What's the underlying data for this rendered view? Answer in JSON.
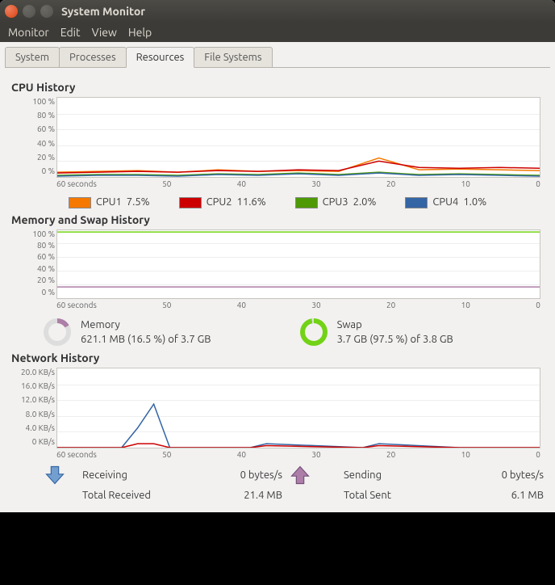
{
  "window": {
    "title": "System Monitor"
  },
  "menu": {
    "items": [
      "Monitor",
      "Edit",
      "View",
      "Help"
    ]
  },
  "tabs": {
    "items": [
      "System",
      "Processes",
      "Resources",
      "File Systems"
    ],
    "active": 2
  },
  "cpu": {
    "title": "CPU History",
    "y_ticks": [
      "100 %",
      "80 %",
      "60 %",
      "40 %",
      "20 %",
      "0 %"
    ],
    "x_ticks": [
      "60",
      "50",
      "40",
      "30",
      "20",
      "10",
      "0"
    ],
    "legend": [
      {
        "label": "CPU1",
        "value": "7.5%",
        "color": "#f57900"
      },
      {
        "label": "CPU2",
        "value": "11.6%",
        "color": "#cc0000"
      },
      {
        "label": "CPU3",
        "value": "2.0%",
        "color": "#4e9a06"
      },
      {
        "label": "CPU4",
        "value": "1.0%",
        "color": "#3465a4"
      }
    ]
  },
  "mem": {
    "title": "Memory and Swap History",
    "y_ticks": [
      "100 %",
      "80 %",
      "60 %",
      "40 %",
      "20 %",
      "0 %"
    ],
    "x_ticks": [
      "60",
      "50",
      "40",
      "30",
      "20",
      "10",
      "0"
    ],
    "memory": {
      "label": "Memory",
      "text": "621.1 MB (16.5 %) of 3.7 GB",
      "pct": 16.5,
      "color": "#ad7fa8"
    },
    "swap": {
      "label": "Swap",
      "text": "3.7 GB (97.5 %) of 3.8 GB",
      "pct": 97.5,
      "color": "#73d216"
    }
  },
  "net": {
    "title": "Network History",
    "y_ticks": [
      "20.0 KB/s",
      "16.0 KB/s",
      "12.0 KB/s",
      "8.0 KB/s",
      "4.0 KB/s",
      "0 KB/s"
    ],
    "x_ticks": [
      "60",
      "50",
      "40",
      "30",
      "20",
      "10",
      "0"
    ],
    "recv": {
      "label": "Receiving",
      "rate": "0 bytes/s",
      "total_label": "Total Received",
      "total": "21.4 MB",
      "color": "#3465a4"
    },
    "send": {
      "label": "Sending",
      "rate": "0 bytes/s",
      "total_label": "Total Sent",
      "total": "6.1 MB",
      "color": "#75507b"
    }
  },
  "chart_data": [
    {
      "type": "line",
      "title": "CPU History",
      "xlabel": "seconds",
      "ylabel": "%",
      "x": [
        60,
        55,
        50,
        45,
        40,
        35,
        30,
        25,
        20,
        15,
        10,
        5,
        0
      ],
      "ylim": [
        0,
        100
      ],
      "series": [
        {
          "name": "CPU1",
          "color": "#f57900",
          "values": [
            6,
            7,
            8,
            6,
            9,
            7,
            8,
            7,
            24,
            9,
            10,
            9,
            8
          ]
        },
        {
          "name": "CPU2",
          "color": "#cc0000",
          "values": [
            5,
            6,
            7,
            6,
            8,
            7,
            9,
            8,
            20,
            12,
            11,
            12,
            11
          ]
        },
        {
          "name": "CPU3",
          "color": "#4e9a06",
          "values": [
            2,
            3,
            3,
            2,
            4,
            3,
            5,
            3,
            6,
            3,
            4,
            3,
            2
          ]
        },
        {
          "name": "CPU4",
          "color": "#3465a4",
          "values": [
            1,
            2,
            2,
            1,
            3,
            2,
            4,
            2,
            5,
            2,
            3,
            2,
            1
          ]
        }
      ]
    },
    {
      "type": "line",
      "title": "Memory and Swap History",
      "xlabel": "seconds",
      "ylabel": "%",
      "x": [
        60,
        0
      ],
      "ylim": [
        0,
        100
      ],
      "series": [
        {
          "name": "Swap",
          "color": "#73d216",
          "values": [
            97.5,
            97.5
          ]
        },
        {
          "name": "Memory",
          "color": "#ad7fa8",
          "values": [
            16.5,
            16.5
          ]
        }
      ]
    },
    {
      "type": "line",
      "title": "Network History",
      "xlabel": "seconds",
      "ylabel": "KB/s",
      "x": [
        60,
        52,
        50,
        48,
        46,
        36,
        34,
        22,
        20,
        10,
        0
      ],
      "ylim": [
        0,
        20
      ],
      "series": [
        {
          "name": "Receiving",
          "color": "#3465a4",
          "values": [
            0,
            0,
            5,
            11,
            0,
            0,
            1,
            0,
            1,
            0,
            0
          ]
        },
        {
          "name": "Sending",
          "color": "#cc0000",
          "values": [
            0,
            0,
            1,
            1,
            0,
            0,
            0.5,
            0,
            0.5,
            0,
            0
          ]
        }
      ]
    }
  ]
}
